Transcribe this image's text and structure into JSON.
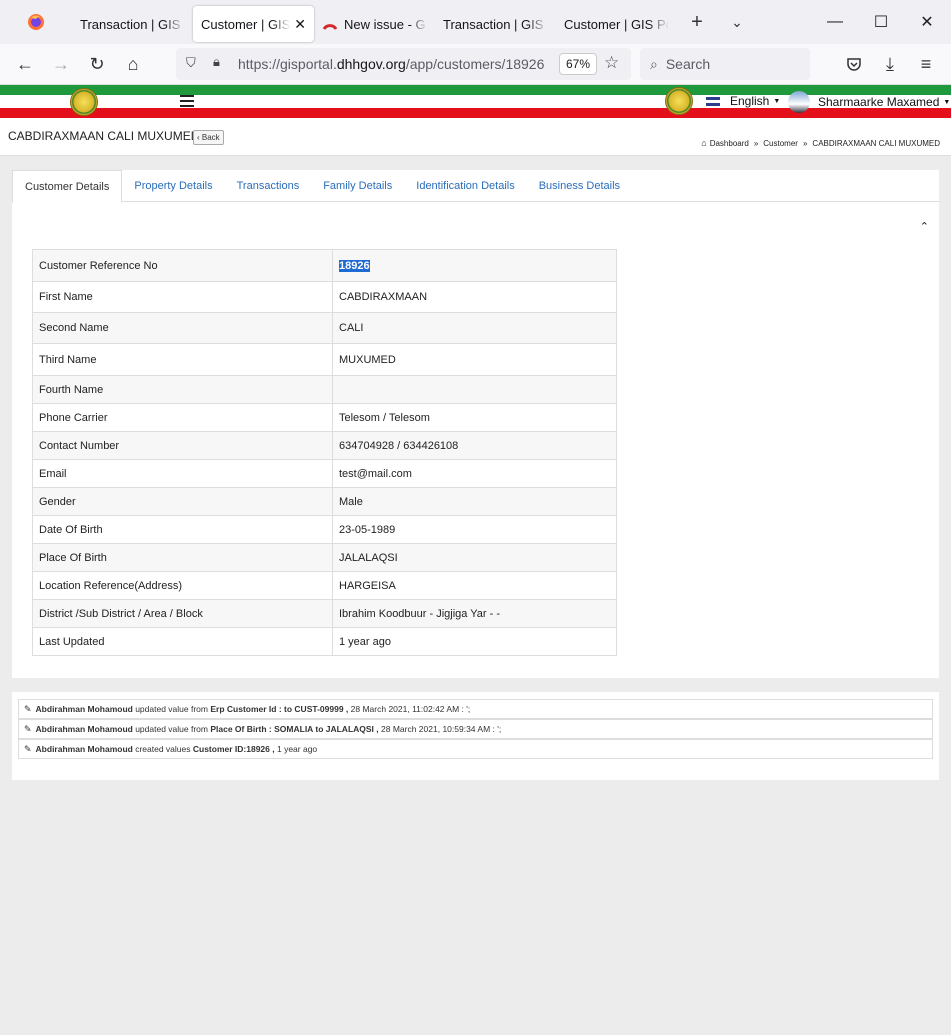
{
  "browser": {
    "tabs": [
      {
        "label": "Transaction | GIS Portal",
        "active": false
      },
      {
        "label": "Customer | GIS Portal",
        "active": true
      },
      {
        "label": "New issue - GIS",
        "active": false
      },
      {
        "label": "Transaction | GIS Portal",
        "active": false
      },
      {
        "label": "Customer | GIS Portal",
        "active": false
      }
    ],
    "url_prefix": "https://gisportal.",
    "url_domain": "dhhgov.org",
    "url_path": "/app/customers/18926",
    "zoom": "67%",
    "search_placeholder": "Search"
  },
  "header": {
    "language": "English",
    "user_name": "Sharmaarke Maxamed"
  },
  "page": {
    "title": "CABDIRAXMAAN CALI MUXUMED",
    "back_label": "Back",
    "breadcrumb": [
      "Dashboard",
      "Customer",
      "CABDIRAXMAAN CALI MUXUMED"
    ]
  },
  "tabs": [
    "Customer Details",
    "Property Details",
    "Transactions",
    "Family Details",
    "Identification Details",
    "Business Details"
  ],
  "details": [
    {
      "label": "Customer Reference No",
      "value": "18926"
    },
    {
      "label": "First Name",
      "value": "CABDIRAXMAAN"
    },
    {
      "label": "Second Name",
      "value": "CALI"
    },
    {
      "label": "Third Name",
      "value": "MUXUMED"
    },
    {
      "label": "Fourth Name",
      "value": ""
    },
    {
      "label": "Phone Carrier",
      "value": "Telesom / Telesom"
    },
    {
      "label": "Contact Number",
      "value": "634704928 / 634426108"
    },
    {
      "label": "Email",
      "value": "test@mail.com"
    },
    {
      "label": "Gender",
      "value": "Male"
    },
    {
      "label": "Date Of Birth",
      "value": "23-05-1989"
    },
    {
      "label": "Place Of Birth",
      "value": "JALALAQSI"
    },
    {
      "label": "Location Reference(Address)",
      "value": "HARGEISA"
    },
    {
      "label": "District /Sub District / Area / Block",
      "value": "Ibrahim Koodbuur - Jigjiga Yar - -"
    },
    {
      "label": "Last Updated",
      "value": "1 year ago"
    }
  ],
  "log": [
    {
      "user": "Abdirahman Mohamoud",
      "action": "updated value from",
      "field": "Erp Customer Id : to CUST-09999 ,",
      "time": "28 March 2021, 11:02:42 AM : ';"
    },
    {
      "user": "Abdirahman Mohamoud",
      "action": "updated value from",
      "field": "Place Of Birth : SOMALIA to JALALAQSI ,",
      "time": "28 March 2021, 10:59:34 AM : ';"
    },
    {
      "user": "Abdirahman Mohamoud",
      "action": "created values",
      "field": "Customer ID:18926 ,",
      "time": "1 year ago"
    }
  ]
}
